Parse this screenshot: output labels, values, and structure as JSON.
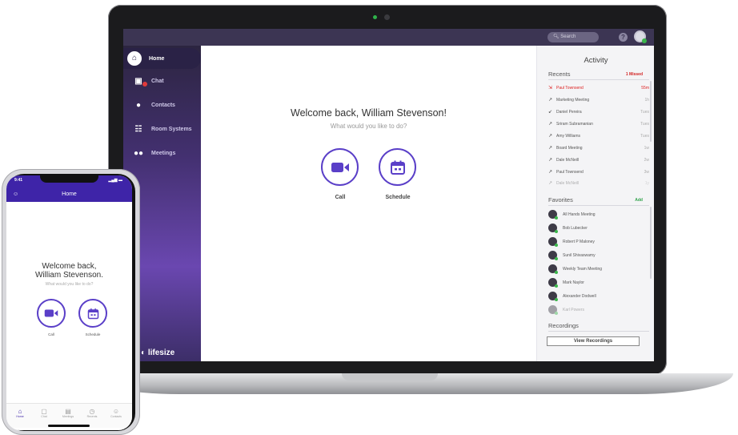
{
  "laptop": {
    "search": {
      "placeholder": "Search"
    },
    "help_glyph": "?",
    "sidebar": {
      "items": [
        {
          "label": "Home",
          "icon": "home-icon"
        },
        {
          "label": "Chat",
          "icon": "chat-icon"
        },
        {
          "label": "Contacts",
          "icon": "contacts-icon"
        },
        {
          "label": "Room Systems",
          "icon": "room-systems-icon"
        },
        {
          "label": "Meetings",
          "icon": "meetings-icon"
        }
      ],
      "brand": "lifesize"
    },
    "main": {
      "welcome": "Welcome back, William Stevenson!",
      "subtitle": "What would you like to do?",
      "call_label": "Call",
      "schedule_label": "Schedule"
    },
    "activity": {
      "title": "Activity",
      "recents_label": "Recents",
      "missed_label": "1 Missed",
      "recents": [
        {
          "name": "Paul Townsend",
          "time": "55m",
          "missed": true
        },
        {
          "name": "Marketing Meeting",
          "time": "1h"
        },
        {
          "name": "Daniel Pereira",
          "time": "Tues"
        },
        {
          "name": "Sriram Subramanian",
          "time": "Tues"
        },
        {
          "name": "Amy Williams",
          "time": "Tues"
        },
        {
          "name": "Board Meeting",
          "time": "1w"
        },
        {
          "name": "Dale McNeill",
          "time": "2w"
        },
        {
          "name": "Paul Townsend",
          "time": "3w"
        },
        {
          "name": "Dale McNeill",
          "time": "1y"
        }
      ],
      "favorites_label": "Favorites",
      "add_label": "Add",
      "favorites": [
        "All Hands Meeting",
        "Bob Lubecker",
        "Robert P Maloney",
        "Sunil Shivaswamy",
        "Weekly Team Meeting",
        "Mark Naylor",
        "Alexander Dodwell",
        "Karl Powers"
      ],
      "recordings_label": "Recordings",
      "view_recordings": "View Recordings"
    },
    "colors": {
      "accent": "#5a3fc8",
      "topbar": "#3c3553",
      "missed": "#d22222",
      "online": "#3ab54a"
    }
  },
  "phone": {
    "status_time": "9:41",
    "title": "Home",
    "welcome_line1": "Welcome back,",
    "welcome_line2": "William Stevenson.",
    "subtitle": "What would you like to do?",
    "call_label": "Call",
    "schedule_label": "Schedule",
    "tabs": [
      {
        "label": "Home",
        "icon": "home-icon"
      },
      {
        "label": "Chat",
        "icon": "chat-icon"
      },
      {
        "label": "Meetings",
        "icon": "meetings-icon"
      },
      {
        "label": "Recents",
        "icon": "recents-icon"
      },
      {
        "label": "Contacts",
        "icon": "contacts-icon"
      }
    ]
  }
}
